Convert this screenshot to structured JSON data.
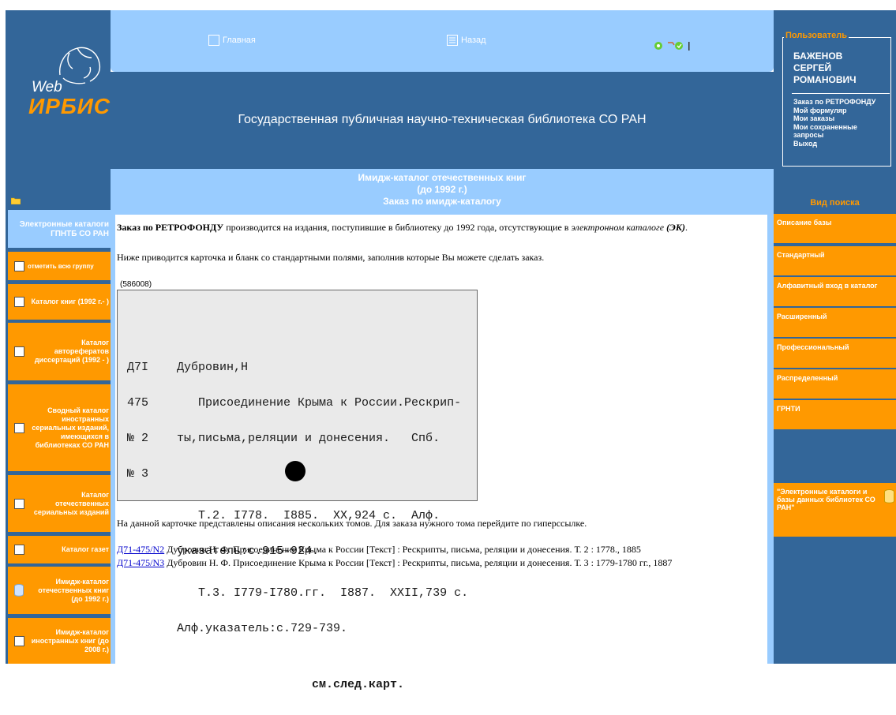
{
  "logo": {
    "web": "Web",
    "irbis": "ИРБИС"
  },
  "nav": {
    "home": "Главная",
    "back": "Назад"
  },
  "library_title": "Государственная публичная научно-техническая библиотека СО РАН",
  "user": {
    "legend": "Пользователь",
    "name_lines": [
      "БАЖЕНОВ",
      "СЕРГЕЙ",
      "РОМАНОВИЧ"
    ],
    "links": [
      "Заказ по РЕТРОФОНДУ",
      "Мой формуляр",
      "Мои заказы",
      "Мои сохраненные запросы",
      "Выход"
    ]
  },
  "search": {
    "title": "Вид поиска",
    "items": [
      "Описание базы",
      "Стандартный",
      "Алфавитный вход в каталог",
      "Расширенный",
      "Профессиональный",
      "Распределенный",
      "ГРНТИ"
    ],
    "footer_link": "\"Электронные каталоги и базы данных библиотек СО РАН\""
  },
  "left": {
    "header": "Электронные каталоги ГПНТБ СО РАН",
    "items": [
      "отметить всю группу",
      "Каталог книг (1992 г.- )",
      "Каталог авторефератов диссертаций (1992 - )",
      "Сводный каталог иностранных сериальных изданий, имеющихся в библиотеках СО РАН",
      "Каталог отечественных сериальных изданий",
      "Каталог газет",
      "Имидж-каталог отечественных книг (до 1992 г.)",
      "Имидж-каталог иностранных книг (до 2008 г.)"
    ]
  },
  "main": {
    "header_lines": [
      "Имидж-каталог отечественных книг",
      "(до 1992 г.)",
      "Заказ по имидж-каталогу"
    ],
    "intro_bold": "Заказ по РЕТРОФОНДУ",
    "intro_text": " производится на издания, поступившие в библиотеку до 1992 года, отсутствующие в ",
    "intro_italic": "электронном каталоге",
    "intro_bolditalic": " (ЭК)",
    "intro_end": ".",
    "line2": "Ниже приводится карточка и бланк со стандартными полями, заполнив которые Вы можете сделать заказ.",
    "card_id": "(586008)",
    "card_lines": [
      "Д7I    Дубровин,Н",
      "475       Присоединение Крыма к России.Рескрип-",
      "№ 2    ты,письма,реляции и донесения.   Спб.",
      "№ 3",
      "          Т.2. I778.  I885.  XX,924 с.  Алф.",
      "       указатель:с.915-924.",
      "          Т.3. I779-I780.гг.  I887.  XXII,739 с.",
      "       Алф.указатель:с.729-739.",
      "                          см.след.карт."
    ],
    "note": "На данной карточке представлены описания нескольких томов. Для заказа нужного тома перейдите по гиперссылке.",
    "records": [
      {
        "link": "Д71-475/N2",
        "text": " Дубровин Н. Ф. Присоединение Крыма к России [Текст] : Рескрипты, письма, реляции и донесения. Т. 2 : 1778., 1885"
      },
      {
        "link": "Д71-475/N3",
        "text": " Дубровин Н. Ф. Присоединение Крыма к России [Текст] : Рескрипты, письма, реляции и донесения. Т. 3 : 1779-1780 гг., 1887"
      }
    ]
  },
  "colors": {
    "dark_blue": "#336699",
    "light_blue": "#99ccff",
    "orange": "#ff9900"
  }
}
